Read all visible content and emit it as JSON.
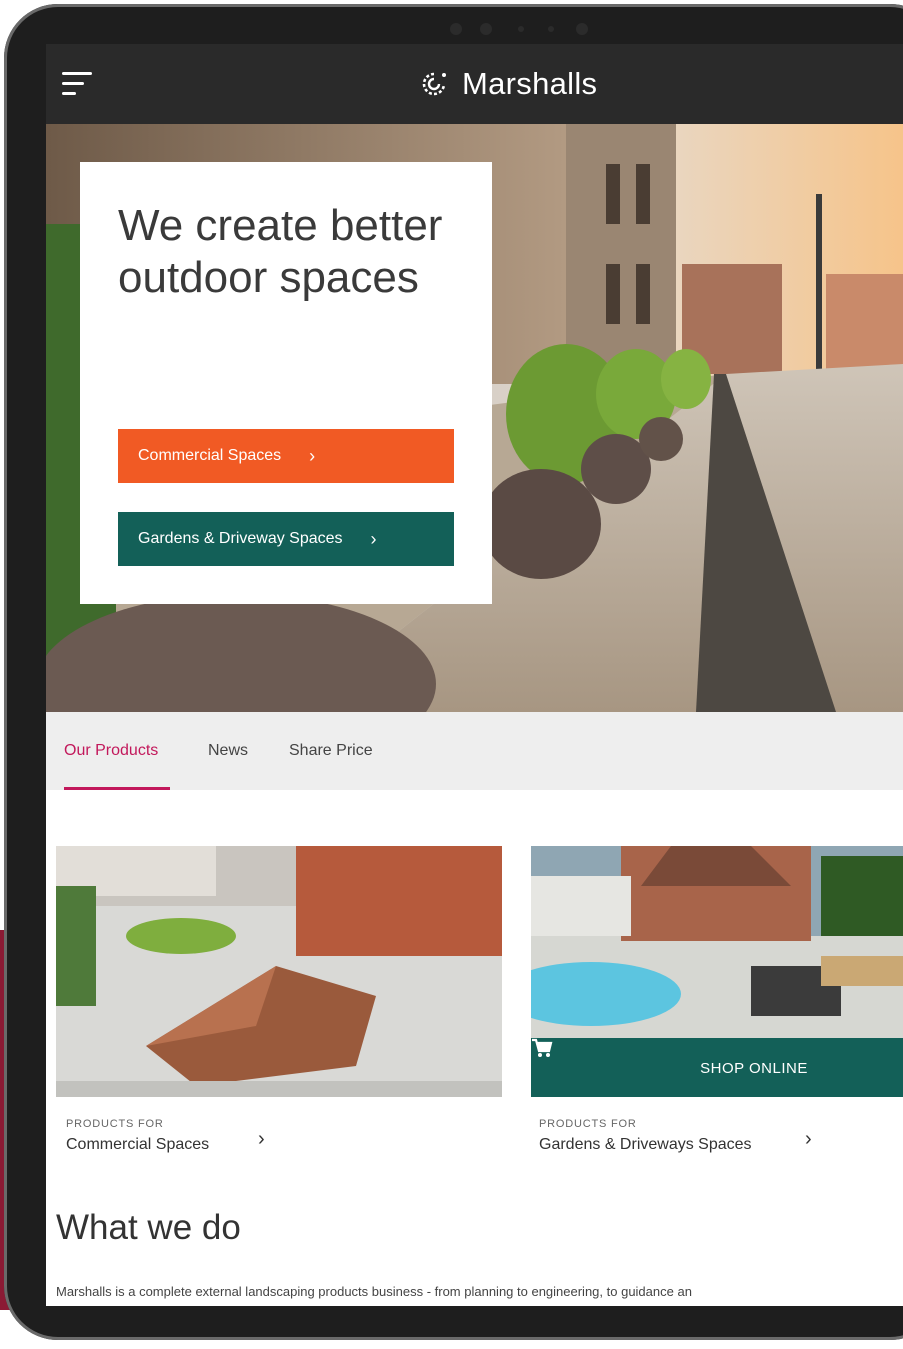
{
  "app": {
    "brand": "Marshalls",
    "accent_orange": "#f15a24",
    "accent_teal": "#136058",
    "accent_pink": "#c2185b"
  },
  "header": {
    "menu_icon": "menu-icon",
    "logo_icon": "marshalls-logo-icon",
    "logo_text": "Marshalls"
  },
  "hero": {
    "title": "We create better outdoor spaces",
    "buttons": [
      {
        "label": "Commercial Spaces",
        "icon": "chevron-right-icon"
      },
      {
        "label": "Gardens & Driveway Spaces",
        "icon": "chevron-right-icon"
      }
    ]
  },
  "tabs": [
    {
      "label": "Our Products",
      "active": true
    },
    {
      "label": "News",
      "active": false
    },
    {
      "label": "Share Price",
      "active": false
    }
  ],
  "products": [
    {
      "kicker": "PRODUCTS FOR",
      "name": "Commercial Spaces"
    },
    {
      "kicker": "PRODUCTS FOR",
      "name": "Gardens & Driveways Spaces",
      "shop_label": "SHOP ONLINE",
      "shop_icon": "cart-icon"
    }
  ],
  "what_we_do": {
    "title": "What we do",
    "text": "Marshalls is a complete external landscaping products business - from planning to engineering, to guidance an"
  },
  "glyphs": {
    "chevron": "›"
  }
}
